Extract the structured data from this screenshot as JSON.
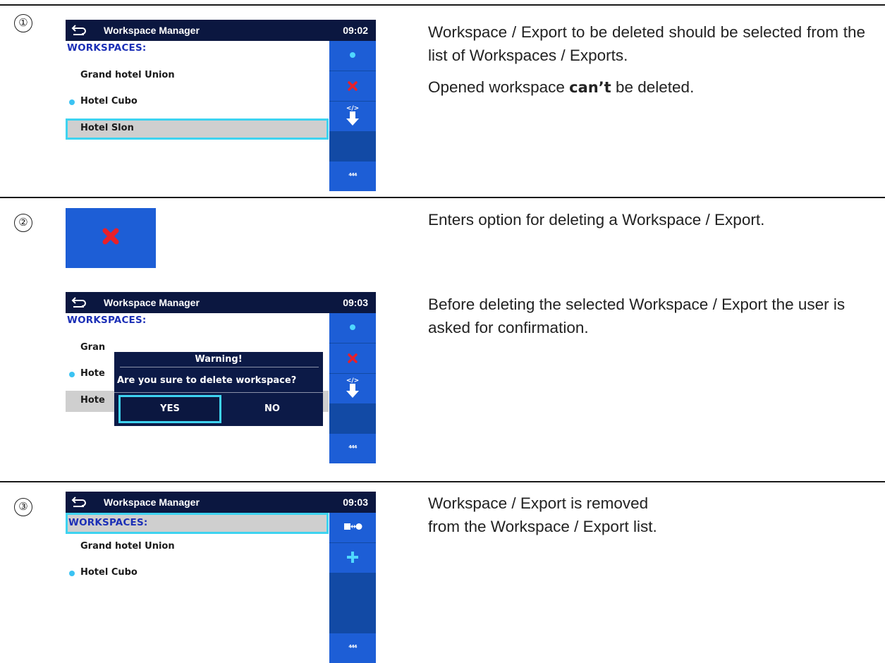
{
  "steps": [
    {
      "number": "①",
      "screen": {
        "title": "Workspace Manager",
        "time": "09:02",
        "section_header": "WORKSPACES:",
        "items": [
          "Grand hotel Union",
          "Hotel Cubo",
          "Hotel Slon"
        ],
        "side_more_label": "⁴⁴⁴"
      },
      "description": {
        "p1": "Workspace / Export to be deleted should be selected from the list of Workspaces / Exports.",
        "p2_before": "Opened workspace ",
        "p2_bold": "can’t",
        "p2_after": " be deleted."
      }
    },
    {
      "number": "②",
      "description_1": "Enters option for deleting a Workspace / Export.",
      "screen": {
        "title": "Workspace Manager",
        "time": "09:03",
        "section_header": "WORKSPACES:",
        "items_partial": [
          "Gran",
          "Hote",
          "Hote"
        ],
        "dialog_title": "Warning!",
        "dialog_message": "Are you sure to delete workspace?",
        "yes_label": "YES",
        "no_label": "NO",
        "side_more_label": "⁴⁴⁴"
      },
      "description_2": "Before deleting the selected Workspace / Export the user is asked for confirmation."
    },
    {
      "number": "③",
      "screen": {
        "title": "Workspace Manager",
        "time": "09:03",
        "section_header": "WORKSPACES:",
        "items": [
          "Grand hotel Union",
          "Hotel Cubo"
        ],
        "side_more_label": "⁴⁴⁴"
      },
      "description": "Workspace / Export is removed from the Workspace / Export list."
    }
  ],
  "icons": {
    "back": "back-arrow-icon",
    "dot": "dot-icon",
    "delete": "red-x-icon",
    "export": "export-arrow-icon",
    "link": "square-link-circle-icon",
    "add": "plus-icon"
  },
  "colors": {
    "title_bar": "#0b1740",
    "side_bar": "#124aa5",
    "side_button": "#1d5ed6",
    "selection_border": "#3ed3f0",
    "header_text": "#1b2fb6",
    "bullet": "#3bc3f3",
    "delete_red": "#e8202a"
  }
}
